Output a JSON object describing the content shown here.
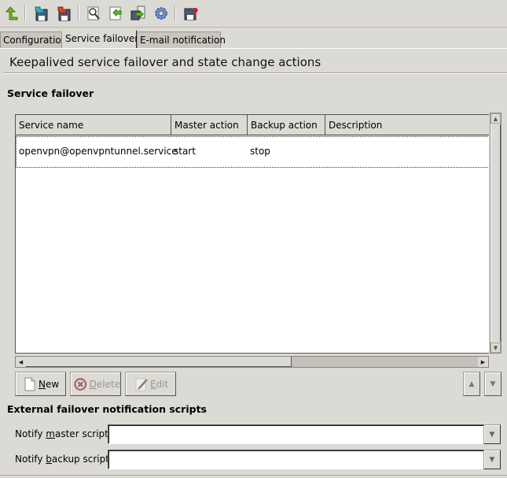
{
  "toolbar": {
    "buttons": [
      {
        "name": "go-up-icon",
        "color": "#5aa516"
      },
      {
        "name": "save-and-return-icon",
        "color": "#27a0b5"
      },
      {
        "name": "revert-icon",
        "color": "#d23a1f"
      },
      {
        "name": "view-preview-icon",
        "color": "#444444"
      },
      {
        "name": "apply-changes-icon",
        "color": "#4caa18"
      },
      {
        "name": "copy-to-host-icon",
        "color": "#4caa18"
      },
      {
        "name": "settings-gear-icon",
        "color": "#5e86c2"
      },
      {
        "name": "help-icon",
        "color": "#e01b1b"
      }
    ]
  },
  "tabs": [
    {
      "label": "Configuration",
      "active": false
    },
    {
      "label": "Service failover",
      "active": true
    },
    {
      "label": "E-mail notification",
      "active": false
    }
  ],
  "page": {
    "title": "Keepalived service failover and state change actions"
  },
  "service_failover": {
    "section_title": "Service failover",
    "columns": [
      "Service name",
      "Master action",
      "Backup action",
      "Description"
    ],
    "rows": [
      {
        "service_name": "openvpn@openvpntunnel.service",
        "master_action": "start",
        "backup_action": "stop",
        "description": ""
      }
    ],
    "buttons": {
      "new": {
        "pre": "",
        "mnemonic": "N",
        "post": "ew",
        "enabled": true
      },
      "delete": {
        "pre": "",
        "mnemonic": "D",
        "post": "elete",
        "enabled": false
      },
      "edit": {
        "pre": "",
        "mnemonic": "E",
        "post": "dit",
        "enabled": false
      }
    },
    "move_up_glyph": "▲",
    "move_down_glyph": "▼"
  },
  "external_scripts": {
    "section_title": "External failover notification scripts",
    "master": {
      "label_pre": "Notify ",
      "label_mnemonic": "m",
      "label_post": "aster script:",
      "value": "",
      "placeholder": ""
    },
    "backup": {
      "label_pre": "Notify ",
      "label_mnemonic": "b",
      "label_post": "ackup script:",
      "value": "",
      "placeholder": ""
    },
    "dropdown_glyph": "▼"
  },
  "scrollbars": {
    "up": "▲",
    "down": "▼",
    "left": "◀",
    "right": "▶"
  }
}
